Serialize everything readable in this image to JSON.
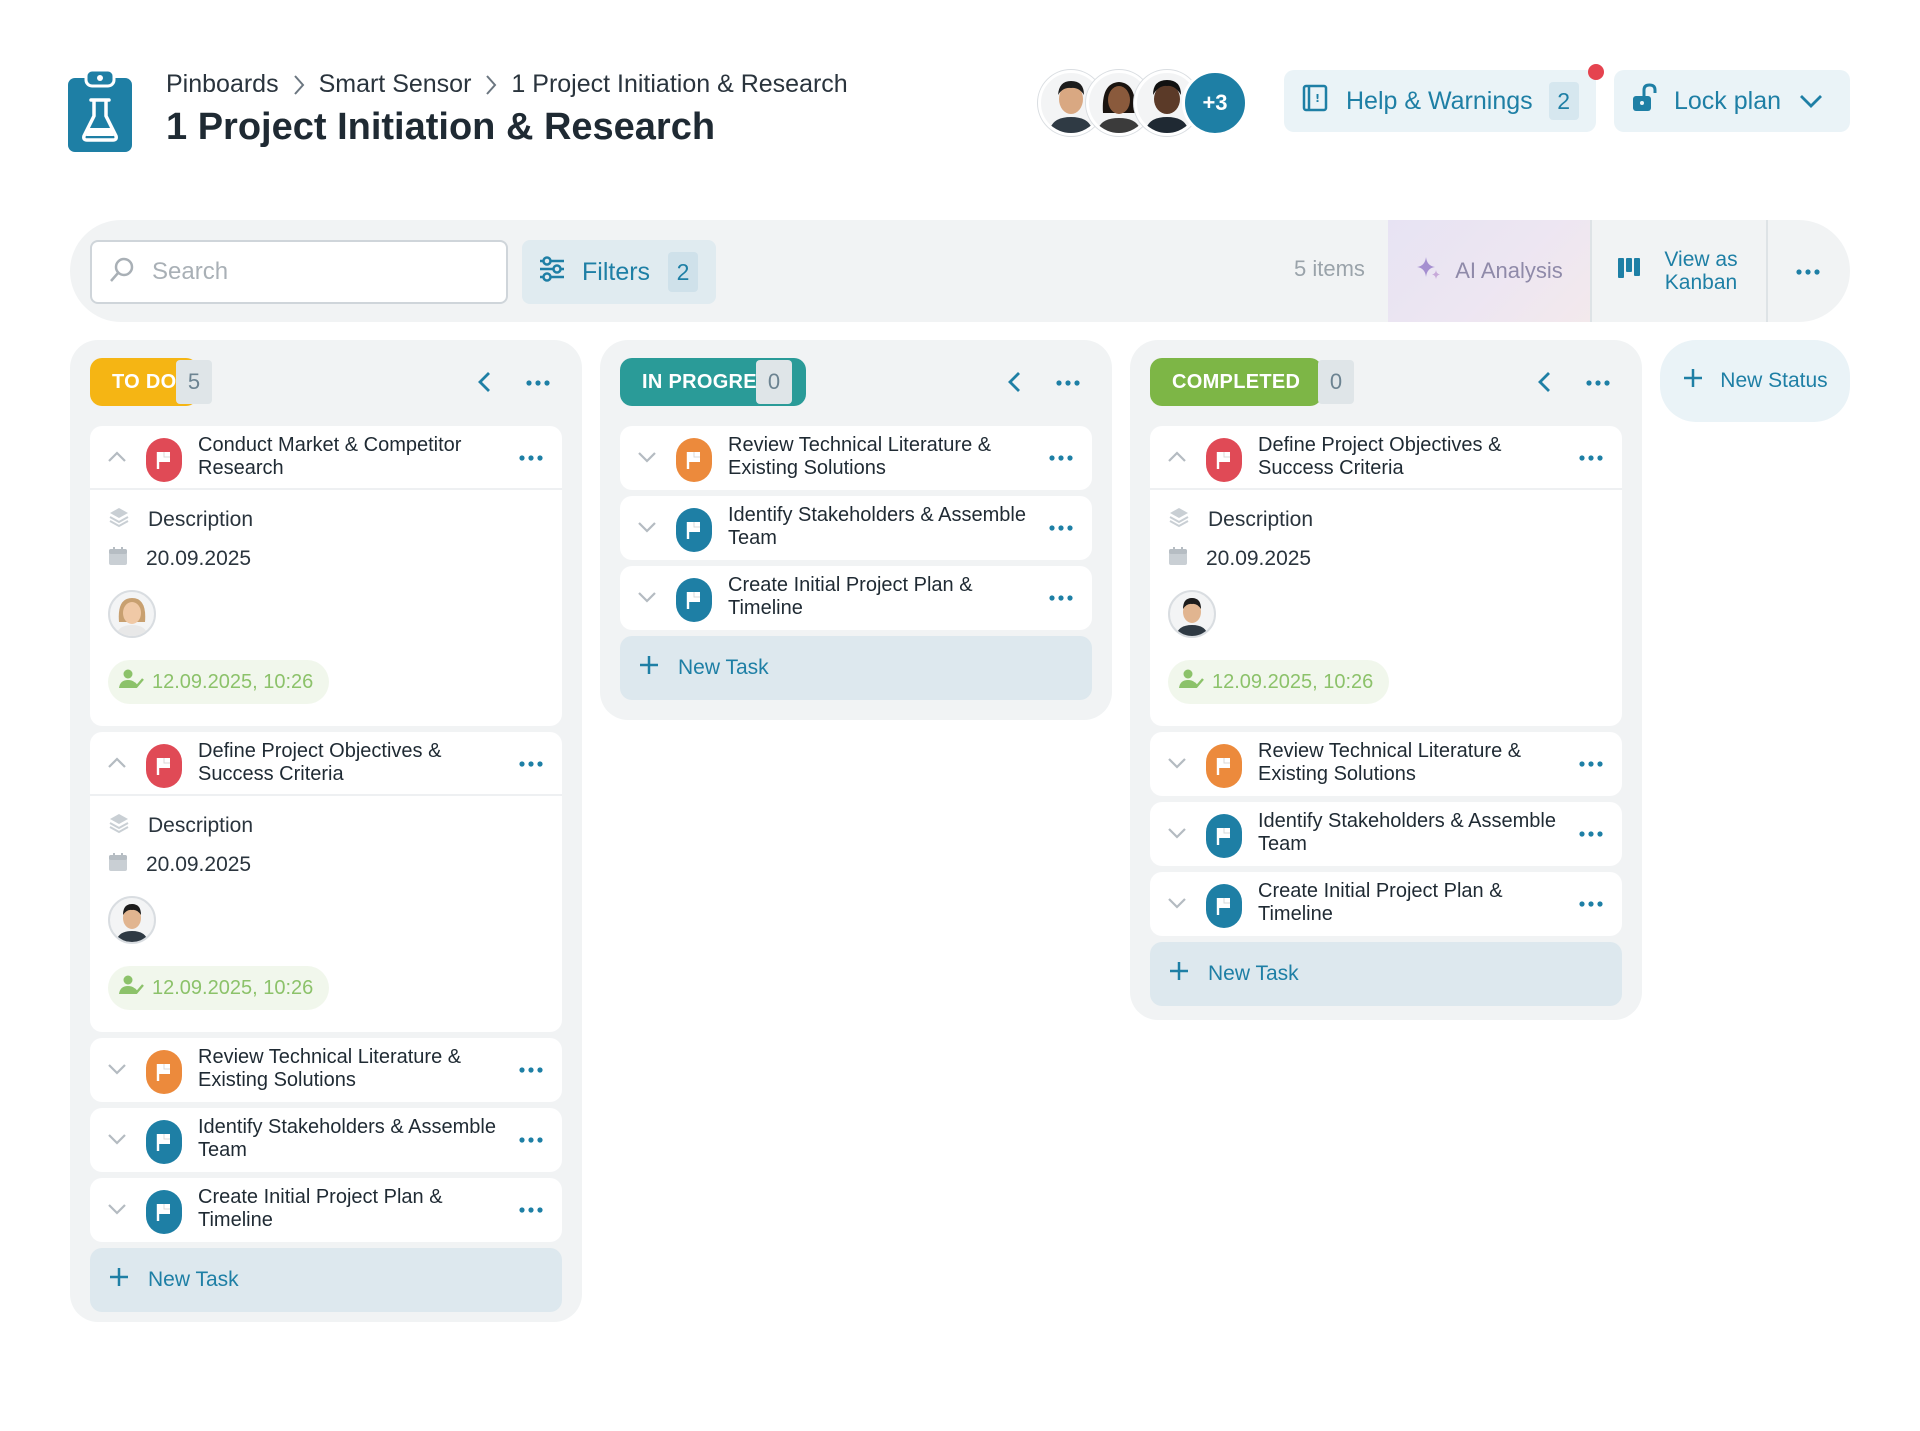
{
  "header": {
    "breadcrumb": [
      "Pinboards",
      "Smart Sensor",
      "1 Project Initiation & Research"
    ],
    "title": "1 Project Initiation & Research",
    "collaborators_more": "+3",
    "help": {
      "label": "Help & Warnings",
      "count": "2"
    },
    "lock": {
      "label": "Lock plan"
    }
  },
  "toolbar": {
    "search_placeholder": "Search",
    "filters_label": "Filters",
    "filters_count": "2",
    "items_count": "5 items",
    "ai_label": "AI Analysis",
    "kanban_label": "View as Kanban"
  },
  "columns": [
    {
      "status": "TO DO",
      "count": "5",
      "color": "#f5b514",
      "cards": [
        {
          "title": "Conduct Market & Competitor Research",
          "flag": "red",
          "expanded": true,
          "description": "Description",
          "date": "20.09.2025",
          "stamp": "12.09.2025, 10:26"
        },
        {
          "title": "Define Project Objectives & Success Criteria",
          "flag": "red",
          "expanded": true,
          "description": "Description",
          "date": "20.09.2025",
          "stamp": "12.09.2025, 10:26"
        },
        {
          "title": "Review Technical Literature & Existing Solutions",
          "flag": "orange",
          "expanded": false
        },
        {
          "title": "Identify Stakeholders & Assemble Team",
          "flag": "blue",
          "expanded": false
        },
        {
          "title": "Create Initial Project Plan & Timeline",
          "flag": "blue",
          "expanded": false
        }
      ],
      "new_task": "New Task"
    },
    {
      "status": "IN PROGRESS",
      "count": "0",
      "color": "#2a9b98",
      "cards": [
        {
          "title": "Review Technical Literature & Existing Solutions",
          "flag": "orange",
          "expanded": false
        },
        {
          "title": "Identify Stakeholders & Assemble Team",
          "flag": "blue",
          "expanded": false
        },
        {
          "title": "Create Initial Project Plan & Timeline",
          "flag": "blue",
          "expanded": false
        }
      ],
      "new_task": "New Task"
    },
    {
      "status": "COMPLETED",
      "count": "0",
      "color": "#7db646",
      "cards": [
        {
          "title": "Define Project Objectives & Success Criteria",
          "flag": "red",
          "expanded": true,
          "description": "Description",
          "date": "20.09.2025",
          "stamp": "12.09.2025, 10:26"
        },
        {
          "title": "Review Technical Literature & Existing Solutions",
          "flag": "orange",
          "expanded": false
        },
        {
          "title": "Identify Stakeholders & Assemble Team",
          "flag": "blue",
          "expanded": false
        },
        {
          "title": "Create Initial Project Plan & Timeline",
          "flag": "blue",
          "expanded": false
        }
      ],
      "new_task": "New Task"
    }
  ],
  "new_status": "New Status",
  "icons": {
    "app": "clipboard-flask-icon",
    "chevron_right": "chevron-right-icon",
    "help": "book-icon",
    "lock": "unlock-icon",
    "search": "search-icon",
    "filters": "sliders-icon",
    "ai": "sparkle-icon",
    "kanban": "kanban-icon",
    "more": "ellipsis-icon",
    "flag": "flag-icon",
    "description": "layers-icon",
    "date": "calendar-icon",
    "stamp": "user-check-icon",
    "add": "plus-icon"
  },
  "colors": {
    "accent": "#1e7fa5",
    "red_flag": "#e04a56",
    "orange_flag": "#ec8a3c",
    "blue_flag": "#1e7fa5",
    "stamp_green": "#8cc26a",
    "notification": "#e5434f"
  }
}
